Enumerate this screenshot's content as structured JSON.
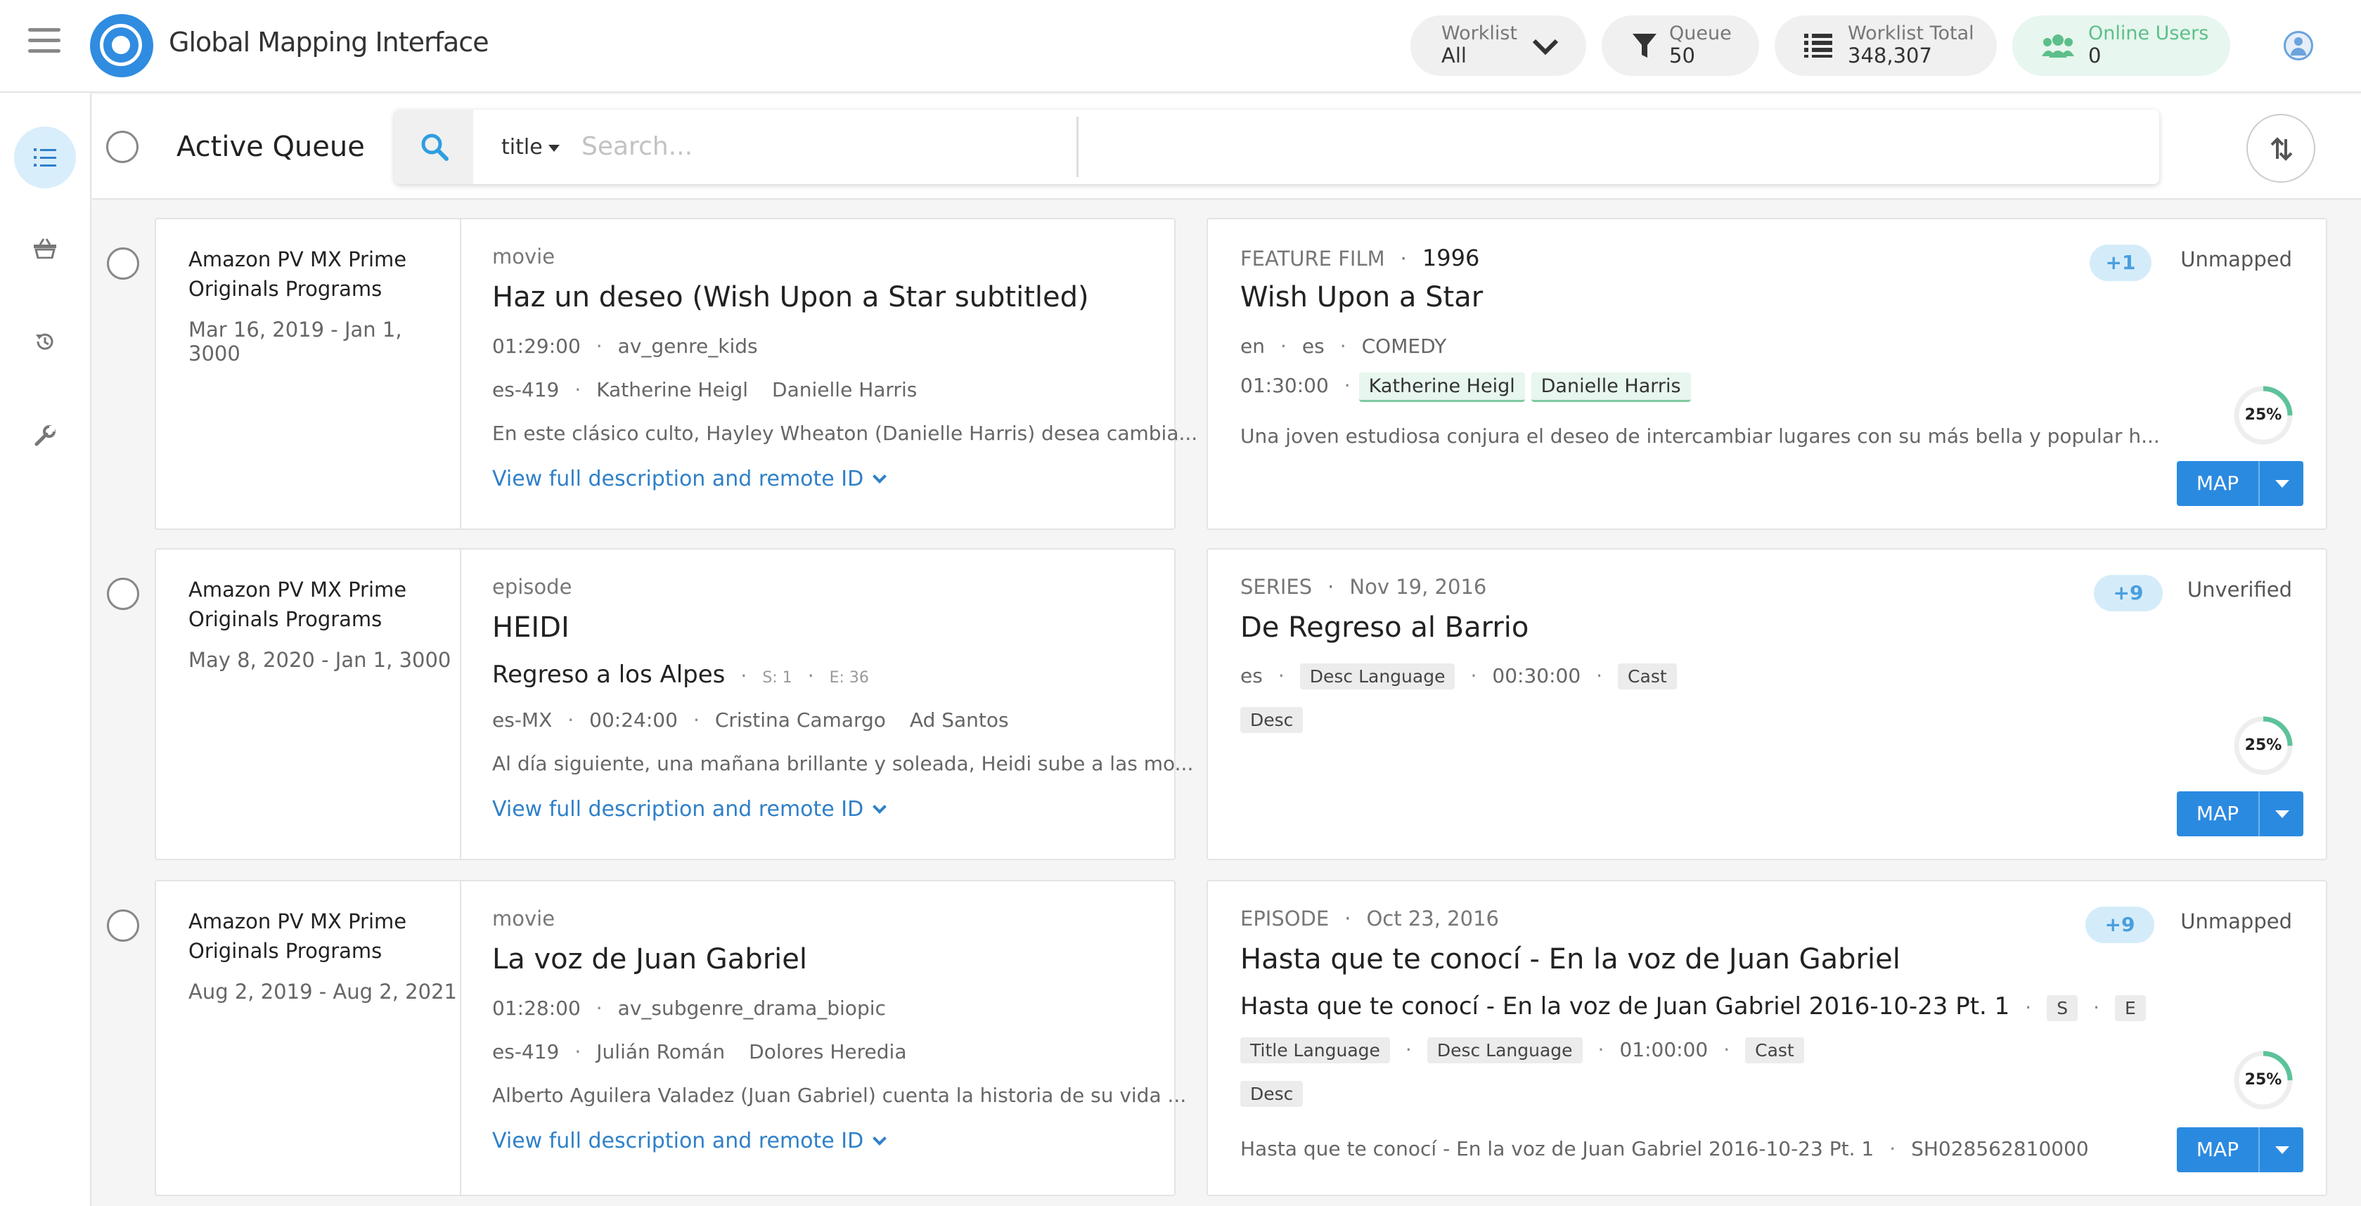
{
  "header": {
    "app_title": "Global Mapping Interface",
    "worklist": {
      "label": "Worklist",
      "value": "All"
    },
    "queue": {
      "label": "Queue",
      "value": "50"
    },
    "worklist_total": {
      "label": "Worklist Total",
      "value": "348,307"
    },
    "online_users": {
      "label": "Online Users",
      "value": "0"
    }
  },
  "colors": {
    "accent": "#2a8ae0",
    "online": "#5cbf8a",
    "badge": "#d4ecfa"
  },
  "toolbar": {
    "title": "Active Queue",
    "search_field": "title",
    "search_placeholder": "Search..."
  },
  "rows": [
    {
      "provider": "Amazon PV MX Prime Originals Programs",
      "dates": "Mar 16, 2019 - Jan 1, 3000",
      "type": "movie",
      "title": "Haz un deseo (Wish Upon a Star subtitled)",
      "runtime": "01:29:00",
      "genre": "av_genre_kids",
      "lang": "es-419",
      "cast": [
        "Katherine Heigl",
        "Danielle Harris"
      ],
      "description": "En este clásico culto, Hayley Wheaton (Danielle Harris) desea cambia...",
      "link": "View full description and remote ID",
      "match": {
        "kind": "FEATURE FILM",
        "year": "1996",
        "title": "Wish Upon a Star",
        "langs": [
          "en",
          "es"
        ],
        "genre": "COMEDY",
        "runtime": "01:30:00",
        "cast": [
          "Katherine Heigl",
          "Danielle Harris"
        ],
        "description": "Una joven estudiosa conjura el deseo de intercambiar lugares con su más bella y popular h...",
        "badge": "+1",
        "status": "Unmapped",
        "progress": "25%",
        "map_label": "MAP"
      }
    },
    {
      "provider": "Amazon PV MX Prime Originals Programs",
      "dates": "May 8, 2020 - Jan 1, 3000",
      "type": "episode",
      "title": "HEIDI",
      "subtitle": "Regreso a los Alpes",
      "season": "S: 1",
      "episode": "E: 36",
      "lang": "es-MX",
      "runtime": "00:24:00",
      "cast": [
        "Cristina Camargo",
        "Ad Santos"
      ],
      "description": "Al día siguiente, una mañana brillante y soleada, Heidi sube a las mo...",
      "link": "View full description and remote ID",
      "match": {
        "kind": "SERIES",
        "date": "Nov 19, 2016",
        "title": "De Regreso al Barrio",
        "lang": "es",
        "tag_desc_lang": "Desc Language",
        "runtime": "00:30:00",
        "tag_cast": "Cast",
        "tag_desc": "Desc",
        "badge": "+9",
        "status": "Unverified",
        "progress": "25%",
        "map_label": "MAP"
      }
    },
    {
      "provider": "Amazon PV MX Prime Originals Programs",
      "dates": "Aug 2, 2019 - Aug 2, 2021",
      "type": "movie",
      "title": "La voz de Juan Gabriel",
      "runtime": "01:28:00",
      "genre": "av_subgenre_drama_biopic",
      "lang": "es-419",
      "cast": [
        "Julián Román",
        "Dolores Heredia"
      ],
      "description": "Alberto Aguilera Valadez (Juan Gabriel) cuenta la historia de su vida ...",
      "link": "View full description and remote ID",
      "match": {
        "kind": "EPISODE",
        "date": "Oct 23, 2016",
        "title": "Hasta que te conocí - En la voz de Juan Gabriel",
        "subtitle": "Hasta que te conocí - En la voz de Juan Gabriel 2016-10-23 Pt. 1",
        "tag_s": "S",
        "tag_e": "E",
        "tag_title_lang": "Title Language",
        "tag_desc_lang": "Desc Language",
        "runtime": "01:00:00",
        "tag_cast": "Cast",
        "tag_desc": "Desc",
        "footer_title": "Hasta que te conocí - En la voz de Juan Gabriel 2016-10-23 Pt. 1",
        "footer_id": "SH028562810000",
        "badge": "+9",
        "status": "Unmapped",
        "progress": "25%",
        "map_label": "MAP"
      }
    }
  ]
}
